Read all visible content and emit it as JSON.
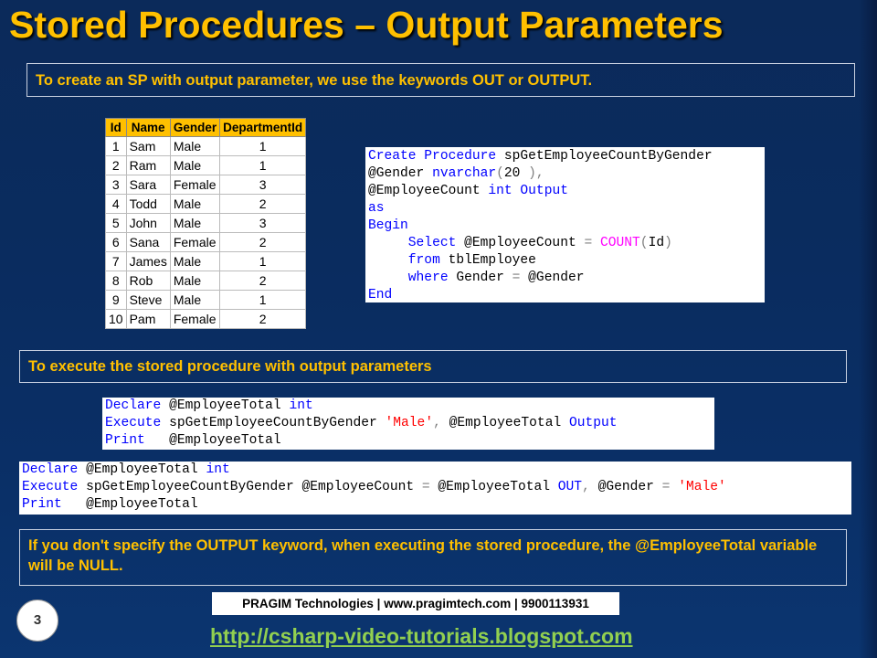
{
  "slide": {
    "title": "Stored Procedures – Output Parameters",
    "note1": "To create an SP with output parameter, we use the keywords OUT or OUTPUT.",
    "note2": "To execute the stored procedure with output parameters",
    "note3": "If you don't specify the OUTPUT keyword, when executing the stored procedure, the @EmployeeTotal variable will be NULL.",
    "footer": "PRAGIM Technologies | www.pragimtech.com | 9900113931",
    "url": "http://csharp-video-tutorials.blogspot.com",
    "page_number": "3"
  },
  "table": {
    "headers": [
      "Id",
      "Name",
      "Gender",
      "DepartmentId"
    ],
    "rows": [
      [
        "1",
        "Sam",
        "Male",
        "1"
      ],
      [
        "2",
        "Ram",
        "Male",
        "1"
      ],
      [
        "3",
        "Sara",
        "Female",
        "3"
      ],
      [
        "4",
        "Todd",
        "Male",
        "2"
      ],
      [
        "5",
        "John",
        "Male",
        "3"
      ],
      [
        "6",
        "Sana",
        "Female",
        "2"
      ],
      [
        "7",
        "James",
        "Male",
        "1"
      ],
      [
        "8",
        "Rob",
        "Male",
        "2"
      ],
      [
        "9",
        "Steve",
        "Male",
        "1"
      ],
      [
        "10",
        "Pam",
        "Female",
        "2"
      ]
    ]
  },
  "code": {
    "create_procedure": [
      [
        [
          "kw",
          "Create Procedure"
        ],
        [
          "t",
          " spGetEmployeeCountByGender"
        ]
      ],
      [
        [
          "t",
          "@Gender "
        ],
        [
          "kw",
          "nvarchar"
        ],
        [
          "op",
          "("
        ],
        [
          "t",
          "20"
        ],
        [
          "op",
          " ),"
        ]
      ],
      [
        [
          "t",
          "@EmployeeCount "
        ],
        [
          "kw",
          "int"
        ],
        [
          "t",
          " "
        ],
        [
          "kw",
          "Output"
        ]
      ],
      [
        [
          "kw",
          "as"
        ]
      ],
      [
        [
          "kw",
          "Begin"
        ]
      ],
      [
        [
          "t",
          "     "
        ],
        [
          "kw",
          "Select"
        ],
        [
          "t",
          " @EmployeeCount "
        ],
        [
          "op",
          "="
        ],
        [
          "t",
          " "
        ],
        [
          "fn",
          "COUNT"
        ],
        [
          "op",
          "("
        ],
        [
          "t",
          "Id"
        ],
        [
          "op",
          ")"
        ]
      ],
      [
        [
          "t",
          "     "
        ],
        [
          "kw",
          "from"
        ],
        [
          "t",
          " tblEmployee"
        ]
      ],
      [
        [
          "t",
          "     "
        ],
        [
          "kw",
          "where"
        ],
        [
          "t",
          " Gender "
        ],
        [
          "op",
          "="
        ],
        [
          "t",
          " @Gender"
        ]
      ],
      [
        [
          "kw",
          "End"
        ]
      ]
    ],
    "execute_positional": [
      [
        [
          "kw",
          "Declare"
        ],
        [
          "t",
          " @EmployeeTotal "
        ],
        [
          "kw",
          "int"
        ]
      ],
      [
        [
          "kw",
          "Execute"
        ],
        [
          "t",
          " spGetEmployeeCountByGender "
        ],
        [
          "str",
          "'Male'"
        ],
        [
          "op",
          ","
        ],
        [
          "t",
          " @EmployeeTotal "
        ],
        [
          "kw",
          "Output"
        ]
      ],
      [
        [
          "kw",
          "Print"
        ],
        [
          "t",
          "   @EmployeeTotal"
        ]
      ]
    ],
    "execute_named": [
      [
        [
          "kw",
          "Declare"
        ],
        [
          "t",
          " @EmployeeTotal "
        ],
        [
          "kw",
          "int"
        ]
      ],
      [
        [
          "kw",
          "Execute"
        ],
        [
          "t",
          " spGetEmployeeCountByGender @EmployeeCount "
        ],
        [
          "op",
          "="
        ],
        [
          "t",
          " @EmployeeTotal "
        ],
        [
          "kw",
          "OUT"
        ],
        [
          "op",
          ","
        ],
        [
          "t",
          " @Gender "
        ],
        [
          "op",
          "="
        ],
        [
          "t",
          " "
        ],
        [
          "str",
          "'Male'"
        ]
      ],
      [
        [
          "kw",
          "Print"
        ],
        [
          "t",
          "   @EmployeeTotal"
        ]
      ]
    ]
  },
  "colors": {
    "title": "#ffc000",
    "keyword": "#0000ff",
    "string": "#ff0000",
    "function": "#ff00ff",
    "operator": "#808080",
    "url": "#92d050"
  }
}
